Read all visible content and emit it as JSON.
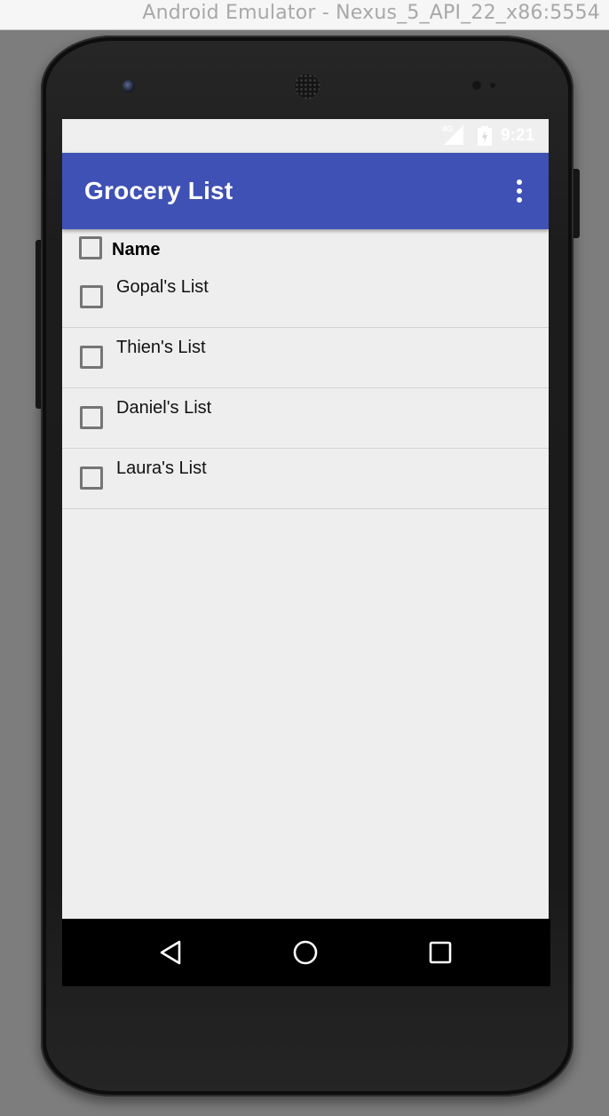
{
  "window": {
    "title": "Android Emulator - Nexus_5_API_22_x86:5554"
  },
  "status_bar": {
    "network": "4G",
    "time": "9:21"
  },
  "app_bar": {
    "title": "Grocery List",
    "background_color": "#3f51b5",
    "overflow_icon": "more-vert-icon"
  },
  "list": {
    "header_label": "Name",
    "header_checked": false,
    "items": [
      {
        "label": "Gopal's List",
        "checked": false
      },
      {
        "label": "Thien's List",
        "checked": false
      },
      {
        "label": "Daniel's List",
        "checked": false
      },
      {
        "label": "Laura's List",
        "checked": false
      }
    ]
  },
  "nav_bar": {
    "icons": [
      "back-icon",
      "home-icon",
      "recents-icon"
    ]
  }
}
